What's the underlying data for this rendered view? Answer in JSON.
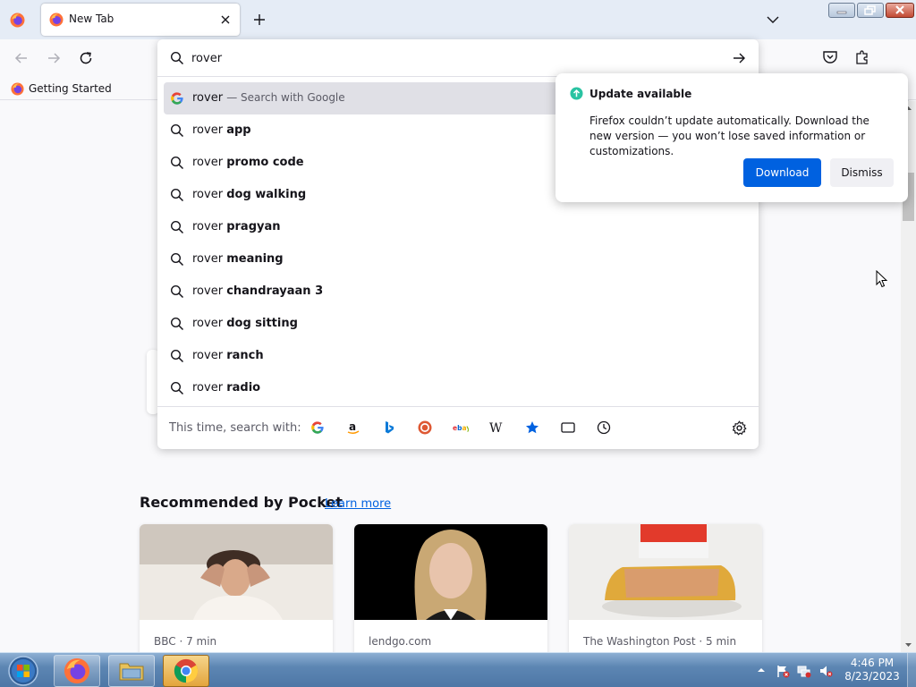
{
  "browser": {
    "tab": {
      "title": "New Tab"
    },
    "bookmarks": [
      {
        "label": "Getting Started"
      }
    ]
  },
  "urlbar": {
    "value": "rover",
    "results": [
      {
        "query": "rover",
        "suffix": "",
        "action": "— Search with Google",
        "type": "search-engine",
        "selected": true
      },
      {
        "query": "rover",
        "suffix": "app",
        "type": "suggestion"
      },
      {
        "query": "rover",
        "suffix": "promo code",
        "type": "suggestion"
      },
      {
        "query": "rover",
        "suffix": "dog walking",
        "type": "suggestion"
      },
      {
        "query": "rover",
        "suffix": "pragyan",
        "type": "suggestion"
      },
      {
        "query": "rover",
        "suffix": "meaning",
        "type": "suggestion"
      },
      {
        "query": "rover",
        "suffix": "chandrayaan 3",
        "type": "suggestion"
      },
      {
        "query": "rover",
        "suffix": "dog sitting",
        "type": "suggestion"
      },
      {
        "query": "rover",
        "suffix": "ranch",
        "type": "suggestion"
      },
      {
        "query": "rover",
        "suffix": "radio",
        "type": "suggestion"
      }
    ],
    "oneoff": {
      "label": "This time, search with:",
      "engines": [
        "google-icon",
        "amazon-icon",
        "bing-icon",
        "duckduckgo-icon",
        "ebay-icon",
        "wikipedia-icon",
        "bookmarks-icon",
        "tabs-icon",
        "history-icon"
      ]
    }
  },
  "update_panel": {
    "title": "Update available",
    "body": "Firefox couldn’t update automatically. Download the new version — you won’t lose saved information or customizations.",
    "download_label": "Download",
    "dismiss_label": "Dismiss"
  },
  "pocket": {
    "title": "Recommended by Pocket",
    "learn_more": "Learn more",
    "cards": [
      {
        "source": "BBC · 7 min"
      },
      {
        "source": "lendgo.com"
      },
      {
        "source": "The Washington Post · 5 min"
      }
    ]
  },
  "taskbar": {
    "time": "4:46 PM",
    "date": "8/23/2023"
  },
  "colors": {
    "accent": "#0061e0",
    "selected_row": "#e0e0e6",
    "update_green": "#2ac3a2"
  }
}
